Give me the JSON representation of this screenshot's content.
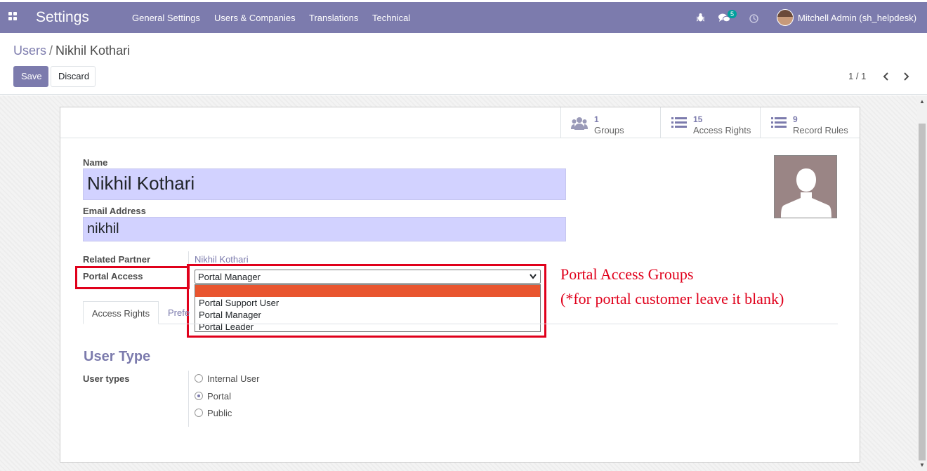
{
  "navbar": {
    "app_title": "Settings",
    "menus": [
      "General Settings",
      "Users & Companies",
      "Translations",
      "Technical"
    ],
    "message_count": "5",
    "user_name": "Mitchell Admin (sh_helpdesk)",
    "color": "#7c7bad"
  },
  "control_panel": {
    "breadcrumb_parent": "Users",
    "breadcrumb_separator": "/",
    "breadcrumb_current": "Nikhil Kothari",
    "save_label": "Save",
    "discard_label": "Discard",
    "pager": "1 / 1"
  },
  "smart_buttons": [
    {
      "count": "1",
      "label": "Groups",
      "icon": "users-icon"
    },
    {
      "count": "15",
      "label": "Access Rights",
      "icon": "list-icon"
    },
    {
      "count": "9",
      "label": "Record Rules",
      "icon": "list-icon"
    }
  ],
  "form": {
    "name_label": "Name",
    "name_value": "Nikhil Kothari",
    "email_label": "Email Address",
    "email_value": "nikhil",
    "related_partner_label": "Related Partner",
    "related_partner_value": "Nikhil Kothari",
    "portal_access_label": "Portal Access",
    "portal_access_selected": "Portal Manager",
    "portal_access_options": [
      "",
      "Portal Support User",
      "Portal Manager",
      "Portal Leader"
    ],
    "tabs": [
      "Access Rights",
      "Prefe"
    ],
    "section_title": "User Type",
    "user_types_label": "User types",
    "user_types": [
      {
        "label": "Internal User",
        "checked": false
      },
      {
        "label": "Portal",
        "checked": true
      },
      {
        "label": "Public",
        "checked": false
      }
    ]
  },
  "annotation": {
    "line1": "Portal Access Groups",
    "line2": "(*for portal customer leave it blank)",
    "color": "#e0001b"
  },
  "dropdown_highlight_color": "#e9552f"
}
